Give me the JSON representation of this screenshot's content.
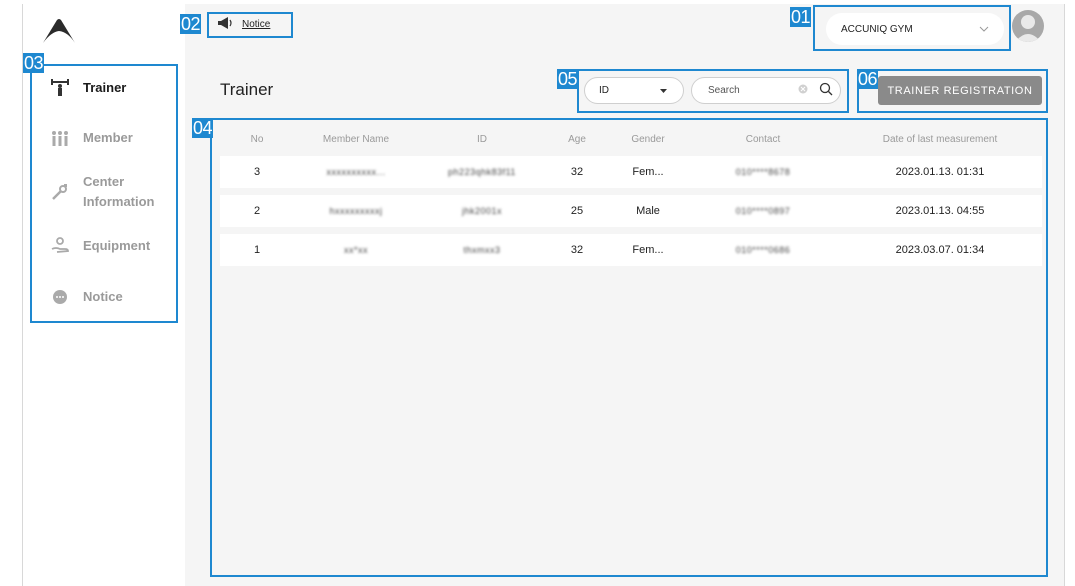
{
  "colors": {
    "accent": "#1e88d0",
    "button_gray": "#8a8a8a",
    "background": "#f5f5f5"
  },
  "annotations": {
    "a01": "01",
    "a02": "02",
    "a03": "03",
    "a04": "04",
    "a05": "05",
    "a06": "06"
  },
  "header": {
    "notice_icon": "megaphone-icon",
    "notice_label": "Notice",
    "gym_select": "ACCUNIQ GYM",
    "avatar_icon": "user-avatar-icon"
  },
  "sidebar": {
    "logo": "accuniq-logo",
    "items": [
      {
        "label": "Trainer",
        "icon": "dumbbell-icon",
        "active": true
      },
      {
        "label": "Member",
        "icon": "group-icon",
        "active": false
      },
      {
        "label": "Center Information",
        "icon": "wrench-icon",
        "active": false
      },
      {
        "label": "Equipment",
        "icon": "hand-icon",
        "active": false
      },
      {
        "label": "Notice",
        "icon": "chat-bubble-icon",
        "active": false
      }
    ]
  },
  "main": {
    "title": "Trainer",
    "filter_select": "ID",
    "search_placeholder": "Search",
    "register_button": "TRAINER REGISTRATION",
    "table": {
      "headers": [
        "No",
        "Member Name",
        "ID",
        "Age",
        "Gender",
        "Contact",
        "Date of last measurement"
      ],
      "rows": [
        {
          "no": "3",
          "name": "xxxxxxxxxx...",
          "id": "ph223qhk83f11",
          "age": "32",
          "gender": "Fem...",
          "contact": "010****8678",
          "date": "2023.01.13. 01:31"
        },
        {
          "no": "2",
          "name": "hxxxxxxxxxj",
          "id": "jhk2001x",
          "age": "25",
          "gender": "Male",
          "contact": "010****0897",
          "date": "2023.01.13. 04:55"
        },
        {
          "no": "1",
          "name": "xx*xx",
          "id": "thxmxx3",
          "age": "32",
          "gender": "Fem...",
          "contact": "010****0686",
          "date": "2023.03.07. 01:34"
        }
      ]
    }
  }
}
